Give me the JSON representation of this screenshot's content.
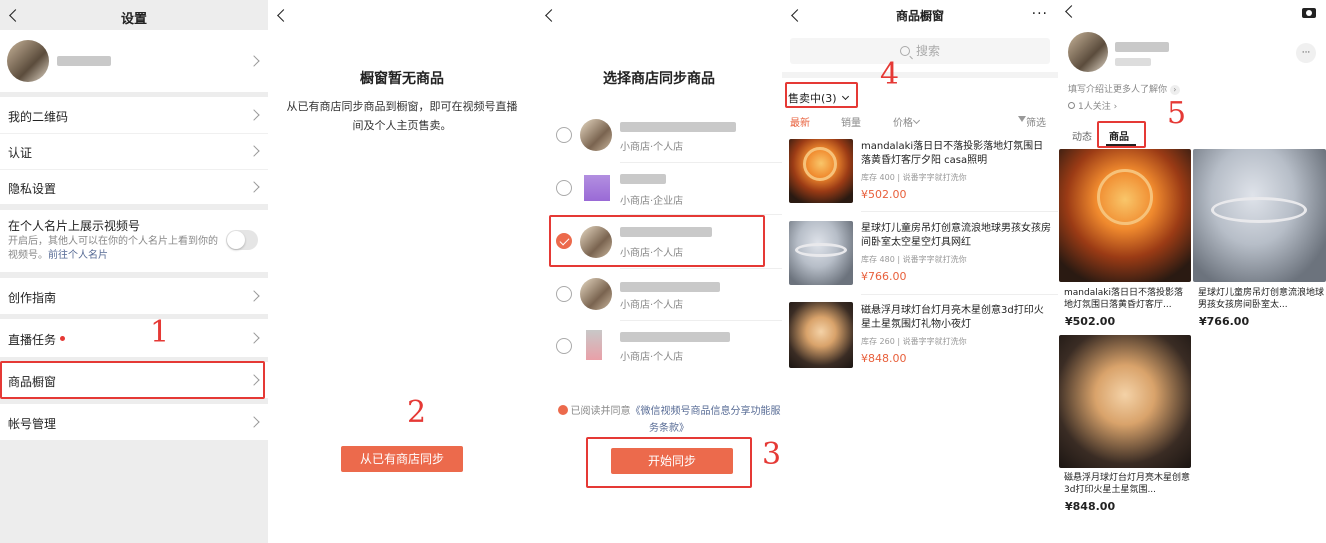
{
  "settings": {
    "title": "设置",
    "items": [
      {
        "label": "我的二维码"
      },
      {
        "label": "认证"
      },
      {
        "label": "隐私设置"
      },
      {
        "label": "创作指南"
      },
      {
        "label": "直播任务"
      },
      {
        "label": "商品橱窗"
      },
      {
        "label": "帐号管理"
      }
    ],
    "card_toggle": {
      "label": "在个人名片上展示视频号",
      "desc": "开启后，其他人可以在你的个人名片上看到你的视频号。",
      "link": "前往个人名片"
    }
  },
  "empty": {
    "title": "橱窗暂无商品",
    "desc": "从已有商店同步商品到橱窗，即可在视频号直播间及个人主页售卖。",
    "button": "从已有商店同步"
  },
  "select": {
    "title": "选择商店同步商品",
    "shops": [
      {
        "type": "小商店·个人店"
      },
      {
        "type": "小商店·企业店"
      },
      {
        "type": "小商店·个人店"
      },
      {
        "type": "小商店·个人店"
      },
      {
        "type": "小商店·个人店"
      }
    ],
    "agree_prefix": "已阅读并同意",
    "agree_link": "《微信视频号商品信息分享功能服务条款》",
    "button": "开始同步"
  },
  "window": {
    "title": "商品橱窗",
    "search_placeholder": "搜索",
    "filter": "售卖中(3)",
    "tabs": [
      "最新",
      "销量",
      "价格",
      "筛选"
    ],
    "products": [
      {
        "title": "mandalaki落日日不落投影落地灯氛围日落黄昏灯客厅夕阳 casa照明",
        "stock": "库存 400",
        "source": "说番字字就打洗你",
        "price": "¥502.00"
      },
      {
        "title": "星球灯儿童房吊灯创意流浪地球男孩女孩房间卧室太空星空灯具网红",
        "stock": "库存 480",
        "source": "说番字字就打洗你",
        "price": "¥766.00"
      },
      {
        "title": "磁悬浮月球灯台灯月亮木星创意3d打印火星土星氛围灯礼物小夜灯",
        "stock": "库存 260",
        "source": "说番字字就打洗你",
        "price": "¥848.00"
      }
    ]
  },
  "profile": {
    "intro": "填写介绍让更多人了解你",
    "followers": "1人关注",
    "tabs": [
      "动态",
      "商品"
    ],
    "cards": [
      {
        "caption": "mandalaki落日日不落投影落地灯氛围日落黄昏灯客厅...",
        "price": "¥502.00"
      },
      {
        "caption": "星球灯儿童房吊灯创意流浪地球男孩女孩房间卧室太...",
        "price": "¥766.00"
      },
      {
        "caption": "磁悬浮月球灯台灯月亮木星创意3d打印火星土星氛围...",
        "price": "¥848.00"
      }
    ]
  },
  "steps": [
    "1",
    "2",
    "3",
    "4",
    "5"
  ],
  "colors": {
    "accent": "#ec6a4c",
    "highlight": "#e53935",
    "price": "#e8603c"
  }
}
